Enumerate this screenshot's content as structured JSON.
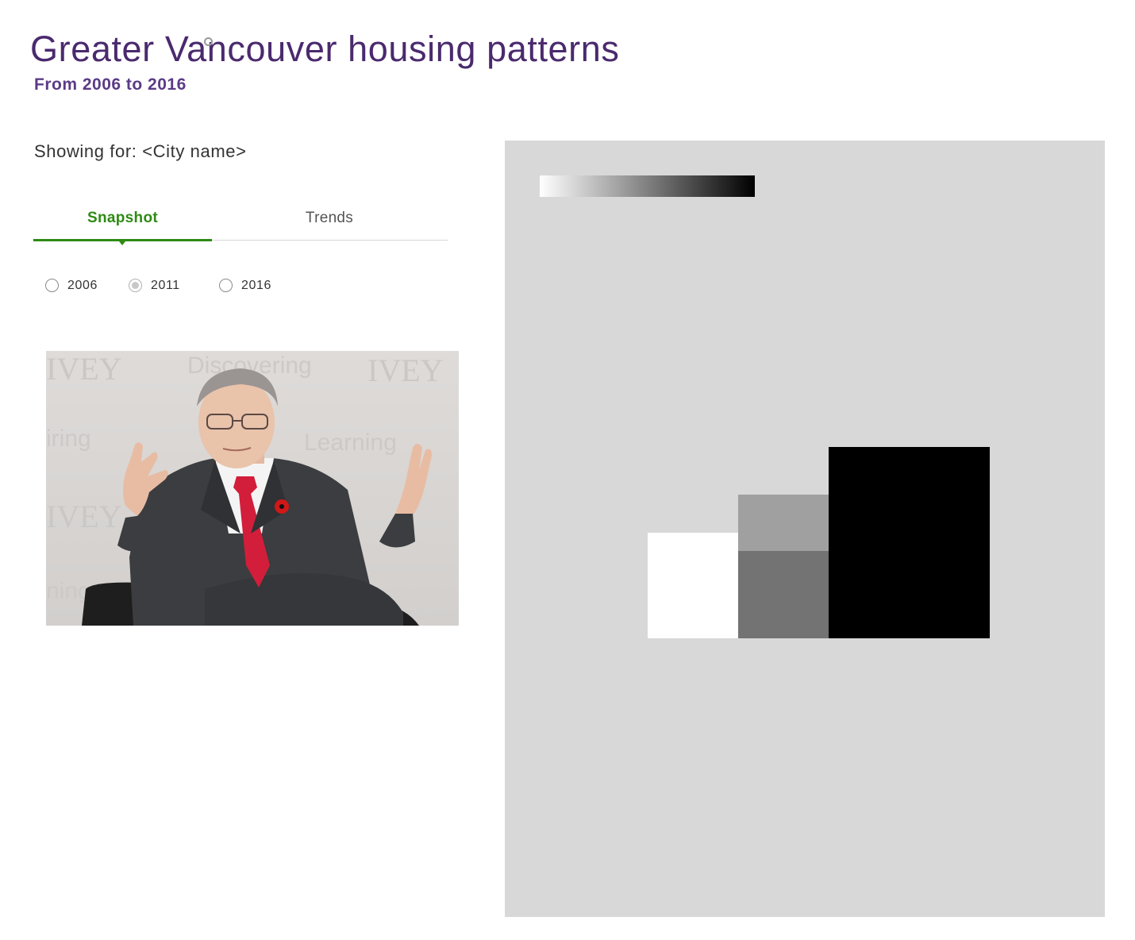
{
  "header": {
    "title": "Greater Vancouver housing patterns",
    "subtitle": "From 2006 to 2016"
  },
  "showing_for": "Showing for: <City name>",
  "tabs": [
    {
      "label": "Snapshot",
      "active": true
    },
    {
      "label": "Trends",
      "active": false
    }
  ],
  "year_options": [
    {
      "label": "2006",
      "checked": false
    },
    {
      "label": "2011",
      "checked": true
    },
    {
      "label": "2016",
      "checked": false
    }
  ],
  "map": {
    "legend_gradient": {
      "from": "#ffffff",
      "to": "#000000"
    },
    "background_color": "#d8d8d8",
    "areas": [
      {
        "shade": "#ffffff"
      },
      {
        "shade": "#a0a0a0"
      },
      {
        "shade": "#737373"
      },
      {
        "shade": "#000000"
      }
    ]
  },
  "colors": {
    "title": "#4a2a6e",
    "accent": "#2e8b14"
  }
}
